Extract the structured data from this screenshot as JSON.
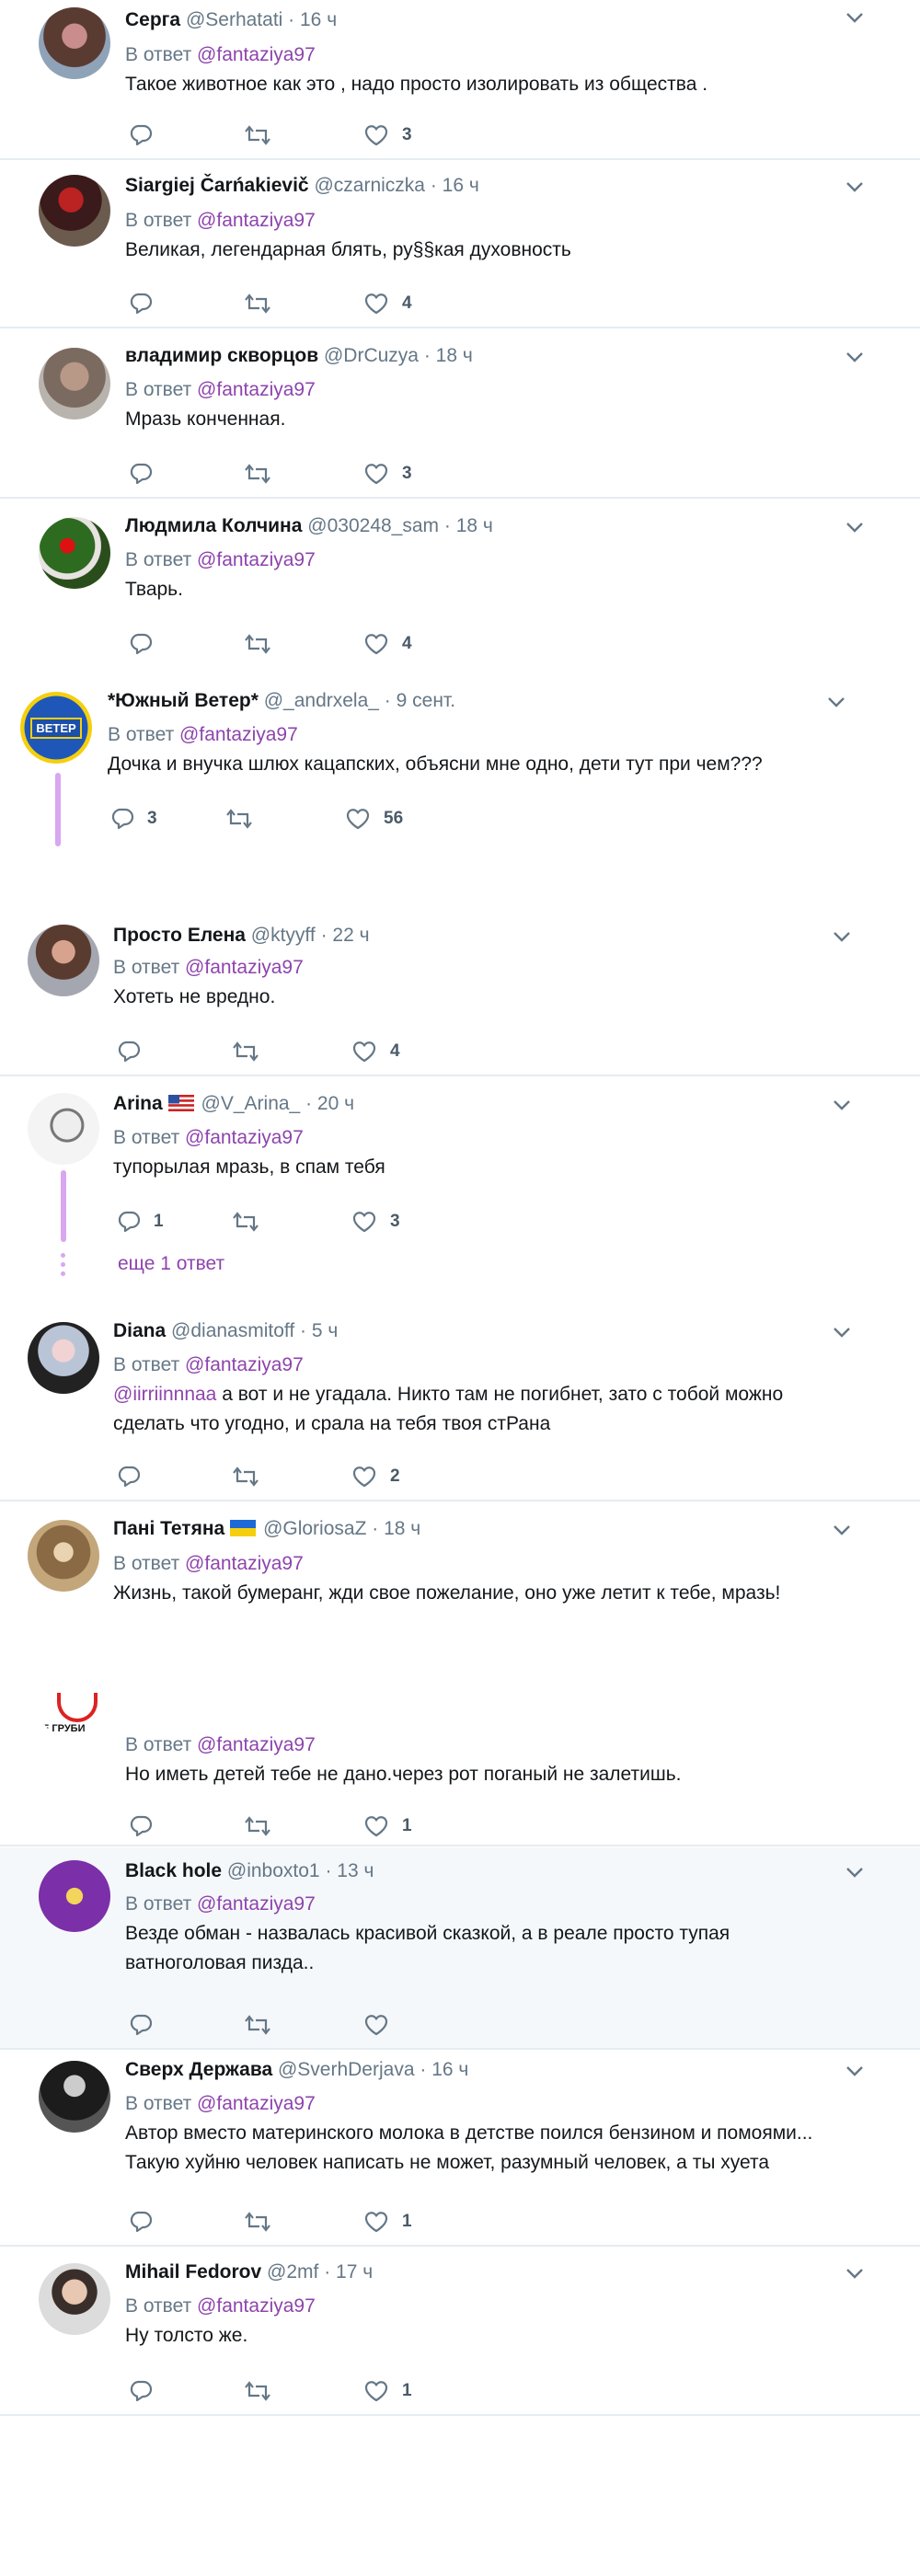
{
  "reply_prefix": "В ответ",
  "tweets": [
    {
      "name": "Серга",
      "handle": "@Serhatati",
      "time": "16 ч",
      "reply_to": "@fantaziya97",
      "lines": [
        "Такое животное как это , надо просто изолировать из общества ."
      ],
      "replies": "",
      "likes": "3",
      "avatar": "woman-photo-avatar"
    },
    {
      "name": "Siargiej Čarńakievič",
      "handle": "@czarniczka",
      "time": "16 ч",
      "reply_to": "@fantaziya97",
      "lines": [
        "Великая, легендарная блять, ру§§кая духовность"
      ],
      "replies": "",
      "likes": "4",
      "avatar": "roses-photo-avatar"
    },
    {
      "name": "владимир скворцов",
      "handle": "@DrCuzya",
      "time": "18 ч",
      "reply_to": "@fantaziya97",
      "lines": [
        "Мразь конченная."
      ],
      "replies": "",
      "likes": "3",
      "avatar": "blurred-face-avatar"
    },
    {
      "name": "Людмила Колчина",
      "handle": "@030248_sam",
      "time": "18 ч",
      "reply_to": "@fantaziya97",
      "lines": [
        "Тварь."
      ],
      "replies": "",
      "likes": "4",
      "avatar": "flowers-photo-avatar"
    },
    {
      "name": "*Южный Ветер*",
      "handle": "@_andrxela_",
      "time": "9 сент.",
      "reply_to": "@fantaziya97",
      "lines": [
        "Дочка и внучка шлюх кацапских, объясни мне одно, дети тут при чем???"
      ],
      "replies": "3",
      "likes": "56",
      "avatar": "southern-wind-logo-avatar",
      "avatar_text": "ВЕТЕР"
    },
    {
      "name": "Просто Елена",
      "handle": "@ktyyff",
      "time": "22 ч",
      "reply_to": "@fantaziya97",
      "lines": [
        "Хотеть не вредно."
      ],
      "replies": "",
      "likes": "4",
      "avatar": "woman-photo-avatar"
    },
    {
      "name": "Arina",
      "handle": "@V_Arina_",
      "time": "20 ч",
      "reply_to": "@fantaziya97",
      "lines": [
        "тупорылая мразь, в спам тебя"
      ],
      "replies": "1",
      "likes": "3",
      "avatar": "woman-sketch-avatar",
      "more_replies": "еще 1 ответ"
    },
    {
      "name": "Diana",
      "handle": "@dianasmitoff",
      "time": "5 ч",
      "reply_to": "@fantaziya97",
      "lines": [
        "@iirriinnnaa а вот и не угадала. Никто там не погибнет, зато с тобой можно",
        "сделать что угодно, и срала на тебя твоя стРана"
      ],
      "mention_in_text": "@iirriinnnaa",
      "replies": "",
      "likes": "2",
      "avatar": "woman-photo-avatar"
    },
    {
      "name": "Пані Тетяна",
      "handle": "@GloriosaZ",
      "time": "18 ч",
      "reply_to": "@fantaziya97",
      "lines": [
        "Жизнь, такой бумеранг, жди свое пожелание, оно уже летит к тебе, мразь!"
      ],
      "replies": "",
      "likes": "",
      "avatar": "painting-avatar"
    },
    {
      "name": "",
      "handle": "",
      "time": "",
      "reply_to": "@fantaziya97",
      "lines": [
        "Но иметь детей тебе не дано.через рот поганый не залетишь."
      ],
      "replies": "",
      "likes": "1",
      "avatar": "do-not-disturb-sign-avatar",
      "avatar_text": "Е ГРУБИ"
    },
    {
      "name": "Black hole",
      "handle": "@inboxto1",
      "time": "13 ч",
      "reply_to": "@fantaziya97",
      "lines": [
        "Везде обман - назвалась красивой сказкой, а в реале просто тупая",
        "ватноголовая пизда.."
      ],
      "replies": "",
      "likes": "",
      "avatar": "rocket-sticker-avatar"
    },
    {
      "name": "Сверх Держава",
      "handle": "@SverhDerjava",
      "time": "16 ч",
      "reply_to": "@fantaziya97",
      "lines": [
        "Автор вместо материнского молока в детстве поился бензином и помоями...",
        "Такую хуйню человек написать не может, разумный человек, а ты хуета"
      ],
      "replies": "",
      "likes": "1",
      "avatar": "man-in-suit-avatar"
    },
    {
      "name": "Mihail Fedorov",
      "handle": "@2mf",
      "time": "17 ч",
      "reply_to": "@fantaziya97",
      "lines": [
        "Ну толсто же."
      ],
      "replies": "",
      "likes": "1",
      "avatar": "man-glasses-avatar"
    }
  ]
}
